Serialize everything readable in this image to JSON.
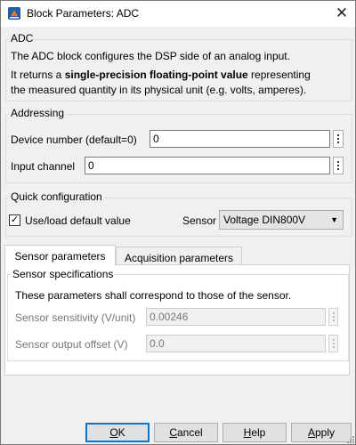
{
  "window": {
    "title": "Block Parameters: ADC",
    "close_glyph": "✕"
  },
  "description": {
    "group_title": "ADC",
    "line1": "The ADC block configures the DSP side of an analog input.",
    "line2_prefix": "It returns a ",
    "line2_bold": "single-precision floating-point value",
    "line2_suffix": " representing",
    "line3": "the measured quantity in its physical unit (e.g. volts, amperes)."
  },
  "addressing": {
    "group_title": "Addressing",
    "device_label": "Device number (default=0)",
    "device_value": "0",
    "channel_label": "Input channel",
    "channel_value": "0"
  },
  "quick_config": {
    "group_title": "Quick configuration",
    "checkbox_label": "Use/load default value",
    "checkbox_checked": true,
    "check_glyph": "✓",
    "sensor_label": "Sensor",
    "sensor_value": "Voltage DIN800V",
    "dropdown_glyph": "▼"
  },
  "tabs": [
    {
      "label": "Sensor parameters",
      "active": true
    },
    {
      "label": "Acquisition parameters",
      "active": false
    }
  ],
  "sensor_specs": {
    "group_title": "Sensor specifications",
    "note": "These parameters shall correspond to those of the sensor.",
    "sensitivity_label": "Sensor sensitivity (V/unit)",
    "sensitivity_value": "0.00246",
    "offset_label": "Sensor output offset (V)",
    "offset_value": "0.0"
  },
  "buttons": {
    "ok": {
      "mnemonic": "O",
      "rest": "K"
    },
    "cancel": {
      "mnemonic": "C",
      "rest": "ancel"
    },
    "help": {
      "mnemonic": "H",
      "rest": "elp"
    },
    "apply": {
      "mnemonic": "A",
      "rest": "pply"
    }
  },
  "colors": {
    "accent": "#0078d7",
    "window_bg": "#f0f0f0",
    "icon_blue": "#1f5fa8",
    "icon_orange": "#e07b1a"
  },
  "icons": {
    "app": "simulink-block-icon",
    "close": "close-icon",
    "check": "checkmark-icon",
    "ellipsis": "ellipsis-vertical-icon",
    "dropdown": "chevron-down-icon",
    "grip": "resize-grip-icon"
  }
}
